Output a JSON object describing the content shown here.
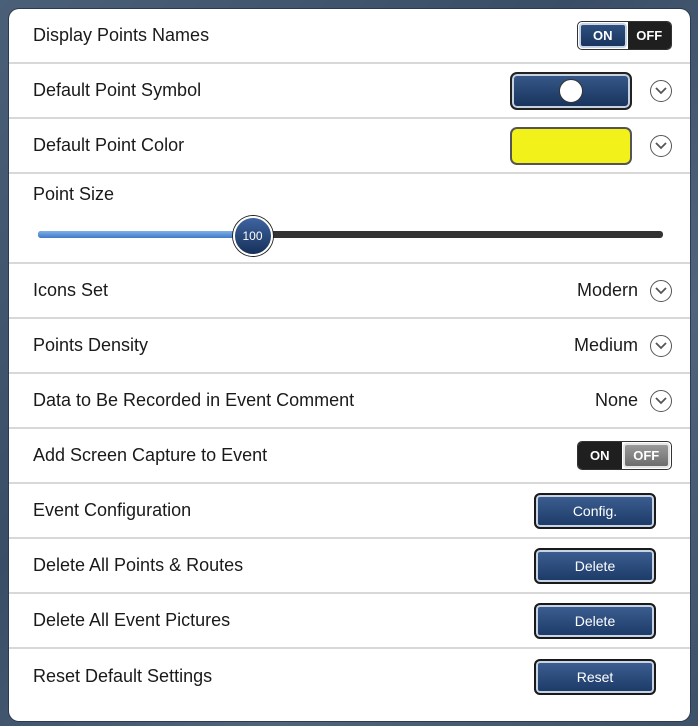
{
  "settings": {
    "display_points_names": {
      "label": "Display Points Names",
      "on": "ON",
      "off": "OFF",
      "state": "on"
    },
    "default_point_symbol": {
      "label": "Default Point Symbol"
    },
    "default_point_color": {
      "label": "Default Point Color",
      "color": "#f2f21a"
    },
    "point_size": {
      "label": "Point Size",
      "value": "100",
      "fraction": 0.34
    },
    "icons_set": {
      "label": "Icons Set",
      "value": "Modern"
    },
    "points_density": {
      "label": "Points Density",
      "value": "Medium"
    },
    "data_event_comment": {
      "label": "Data to Be Recorded in Event Comment",
      "value": "None"
    },
    "add_screen_capture": {
      "label": "Add Screen Capture to Event",
      "on": "ON",
      "off": "OFF",
      "state": "off"
    },
    "event_configuration": {
      "label": "Event Configuration",
      "button": "Config."
    },
    "delete_points_routes": {
      "label": "Delete All Points & Routes",
      "button": "Delete"
    },
    "delete_event_pictures": {
      "label": "Delete All Event Pictures",
      "button": "Delete"
    },
    "reset_defaults": {
      "label": "Reset Default Settings",
      "button": "Reset"
    }
  },
  "icons": {
    "dropdown": "chevron-down-circle-icon",
    "symbol": "circle-symbol-icon"
  }
}
